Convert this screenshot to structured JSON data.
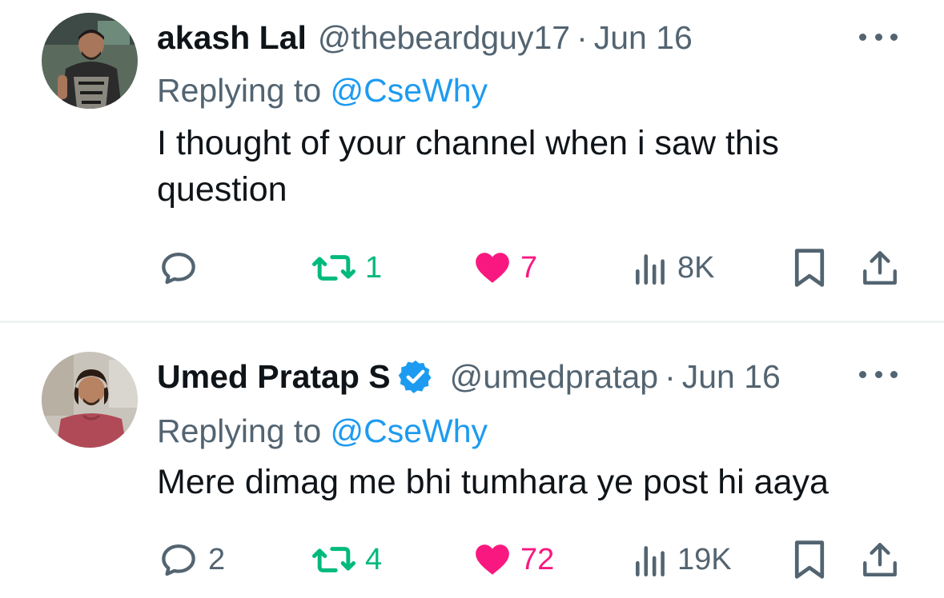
{
  "replies": [
    {
      "display_name": "akash Lal",
      "verified": false,
      "handle": "@thebeardguy17",
      "separator": "·",
      "date": "Jun 16",
      "replying_prefix": "Replying to ",
      "replying_to": "@CseWhy",
      "text": "I thought of your channel when i saw this question",
      "actions": {
        "reply_count": "",
        "retweet_count": "1",
        "like_count": "7",
        "views_count": "8K"
      }
    },
    {
      "display_name": "Umed Pratap S",
      "verified": true,
      "handle": "@umedpratap",
      "separator": "·",
      "date": "Jun 16",
      "replying_prefix": "Replying to ",
      "replying_to": "@CseWhy",
      "text": "Mere dimag me bhi tumhara ye post hi aaya",
      "actions": {
        "reply_count": "2",
        "retweet_count": "4",
        "like_count": "72",
        "views_count": "19K"
      }
    }
  ],
  "colors": {
    "text_primary": "#0f1419",
    "text_secondary": "#536471",
    "link": "#1d9bf0",
    "retweet_active": "#00ba7c",
    "like_active": "#f91880",
    "verified_badge": "#1d9bf0"
  },
  "icons": [
    "reply-icon",
    "retweet-icon",
    "heart-icon",
    "views-icon",
    "bookmark-icon",
    "share-icon",
    "more-icon",
    "verified-icon"
  ]
}
